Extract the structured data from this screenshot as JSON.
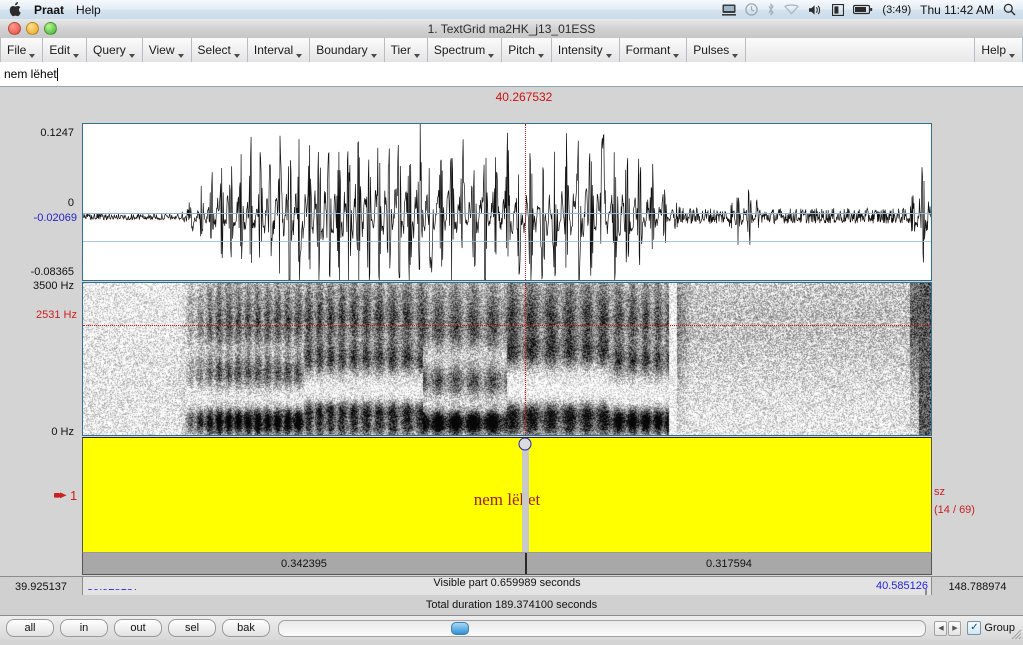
{
  "mac_menu": {
    "apple_icon": "apple-logo-icon",
    "app_name": "Praat",
    "help": "Help",
    "status_icons": [
      {
        "name": "display-sharing-icon",
        "glyph": "▤"
      },
      {
        "name": "time-machine-icon",
        "glyph": "◴"
      },
      {
        "name": "bluetooth-icon",
        "glyph": "ᛦ"
      },
      {
        "name": "airport-wifi-icon",
        "glyph": "▽"
      },
      {
        "name": "volume-icon",
        "glyph": "🔊"
      },
      {
        "name": "input-source-icon",
        "glyph": "▣"
      }
    ],
    "battery_icon": "battery-icon",
    "battery_time": "(3:49)",
    "clock": "Thu 11:42 AM",
    "spotlight_icon": "search-icon"
  },
  "window": {
    "title": "1. TextGrid ma2HK_j13_01ESS",
    "close_button": "close-button",
    "minimize_button": "minimize-button",
    "zoom_button": "zoom-button"
  },
  "menubar": {
    "items": [
      {
        "label": "File"
      },
      {
        "label": "Edit"
      },
      {
        "label": "Query"
      },
      {
        "label": "View"
      },
      {
        "label": "Select"
      },
      {
        "label": "Interval"
      },
      {
        "label": "Boundary"
      },
      {
        "label": "Tier"
      },
      {
        "label": "Spectrum"
      },
      {
        "label": "Pitch"
      },
      {
        "label": "Intensity"
      },
      {
        "label": "Formant"
      },
      {
        "label": "Pulses"
      }
    ],
    "help_label": "Help"
  },
  "entry": {
    "value": "nem lëhet",
    "placeholder": ""
  },
  "cursor": {
    "time_label": "40.267532",
    "time_value": 40.267532
  },
  "waveform": {
    "max_label": "0.1247",
    "zero_label": "0",
    "selected_label": "-0.02069",
    "min_label": "-0.08365",
    "max_value": 0.1247,
    "min_value": -0.08365,
    "cursor_amplitude": -0.02069
  },
  "spectrogram": {
    "top_label": "3500 Hz",
    "cursor_label": "2531 Hz",
    "bottom_label": "0 Hz",
    "top_value": 3500,
    "cursor_value": 2531,
    "bottom_value": 0
  },
  "tier": {
    "number": "1",
    "hand_icon": "pointing-hand-icon",
    "interval_text": "nem lëhet",
    "right_label": "sz",
    "right_count": "(14 / 69)",
    "interval_color": "#ffff00"
  },
  "durations": {
    "left": "0.342395",
    "right": "0.317594",
    "left_value": 0.342395,
    "right_value": 0.317594
  },
  "status": {
    "window_start": "39.925137",
    "selection_start": "39.925137",
    "visible_part": "Visible part 0.659989 seconds",
    "selection_end": "40.585126",
    "window_end": "148.788974",
    "total_duration": "Total duration 189.374100 seconds"
  },
  "bottom_toolbar": {
    "buttons": [
      {
        "label": "all",
        "name": "zoom-all-button"
      },
      {
        "label": "in",
        "name": "zoom-in-button"
      },
      {
        "label": "out",
        "name": "zoom-out-button"
      },
      {
        "label": "sel",
        "name": "zoom-selection-button"
      },
      {
        "label": "bak",
        "name": "zoom-back-button"
      }
    ],
    "scroll_left_icon": "arrow-left-icon",
    "scroll_right_icon": "arrow-right-icon",
    "group_label": "Group",
    "group_checked": true,
    "checkmark": "✓"
  },
  "colors": {
    "cursor_red": "#d01010",
    "selection_blue": "#2222dd",
    "tier_yellow": "#ffff00",
    "panel_border": "#2f6f8f",
    "interval_text": "#a02020"
  }
}
